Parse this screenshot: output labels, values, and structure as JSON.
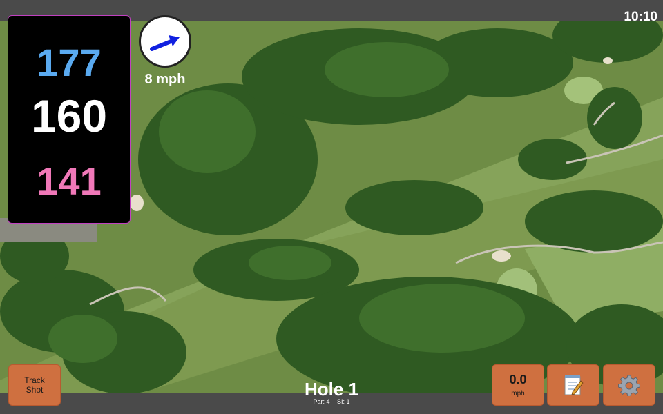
{
  "status": {
    "time": "10:10"
  },
  "distances": {
    "back": "177",
    "middle": "160",
    "front": "141"
  },
  "wind": {
    "speed": "8 mph",
    "icon": "wind-arrow-icon"
  },
  "buttons": {
    "track_shot_line1": "Track",
    "track_shot_line2": "Shot",
    "speed_value": "0.0",
    "speed_unit": "mph",
    "notes_icon": "notepad-icon",
    "settings_icon": "gear-icon"
  },
  "hole": {
    "title": "Hole 1",
    "par": "Par: 4",
    "si": "SI: 1"
  },
  "colors": {
    "back": "#5aaaf0",
    "middle": "#ffffff",
    "front": "#f078b8",
    "button": "#cf7040",
    "bar": "#4a4a4a",
    "accent": "#c040c0"
  }
}
